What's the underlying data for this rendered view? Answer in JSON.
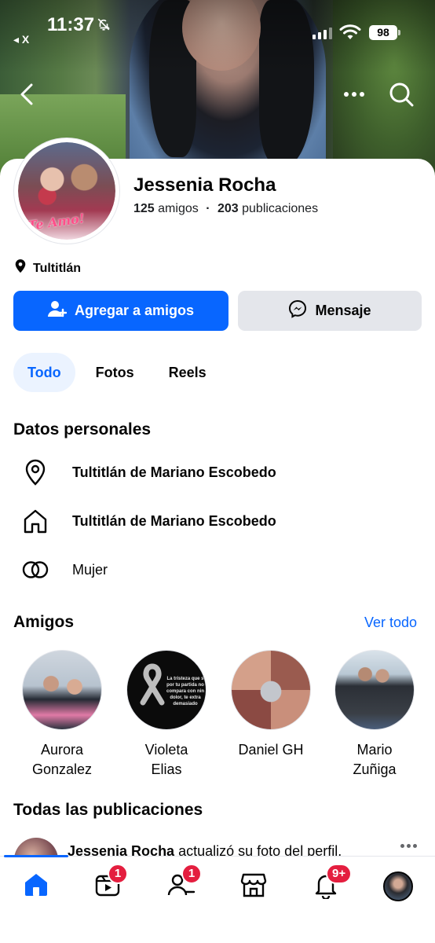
{
  "status_bar": {
    "time": "11:37",
    "back_app": "◂ X",
    "battery": "98"
  },
  "profile": {
    "name": "Jessenia Rocha",
    "friends_count": "125",
    "friends_label": "amigos",
    "posts_count": "203",
    "posts_label": "publicaciones",
    "location": "Tultitlán",
    "avatar_caption": "Te Amo!"
  },
  "actions": {
    "add_friend": "Agregar a amigos",
    "message": "Mensaje"
  },
  "tabs": [
    {
      "label": "Todo",
      "active": true
    },
    {
      "label": "Fotos",
      "active": false
    },
    {
      "label": "Reels",
      "active": false
    }
  ],
  "personal": {
    "heading": "Datos personales",
    "items": [
      {
        "icon": "location-pin-icon",
        "text": "Tultitlán de Mariano Escobedo"
      },
      {
        "icon": "home-icon",
        "text": "Tultitlán de Mariano Escobedo"
      },
      {
        "icon": "gender-icon",
        "text": "Mujer"
      }
    ]
  },
  "friends_section": {
    "heading": "Amigos",
    "see_all": "Ver todo",
    "items": [
      {
        "name_line1": "Aurora",
        "name_line2": "Gonzalez"
      },
      {
        "name_line1": "Violeta",
        "name_line2": "Elias"
      },
      {
        "name_line1": "Daniel GH",
        "name_line2": ""
      },
      {
        "name_line1": "Mario",
        "name_line2": "Zuñiga"
      }
    ],
    "violeta_photo_text": "La tristeza que s por tu partida no compara con nin dolor, te extra demasiado"
  },
  "posts": {
    "heading": "Todas las publicaciones",
    "first_author": "Jessenia Rocha",
    "first_action": "actualizó su foto del perfil."
  },
  "bottom_nav": {
    "video_badge": "1",
    "friends_badge": "1",
    "notifications_badge": "9+"
  },
  "colors": {
    "accent": "#0866ff",
    "badge": "#e41e3f",
    "button_gray": "#e4e6eb"
  }
}
